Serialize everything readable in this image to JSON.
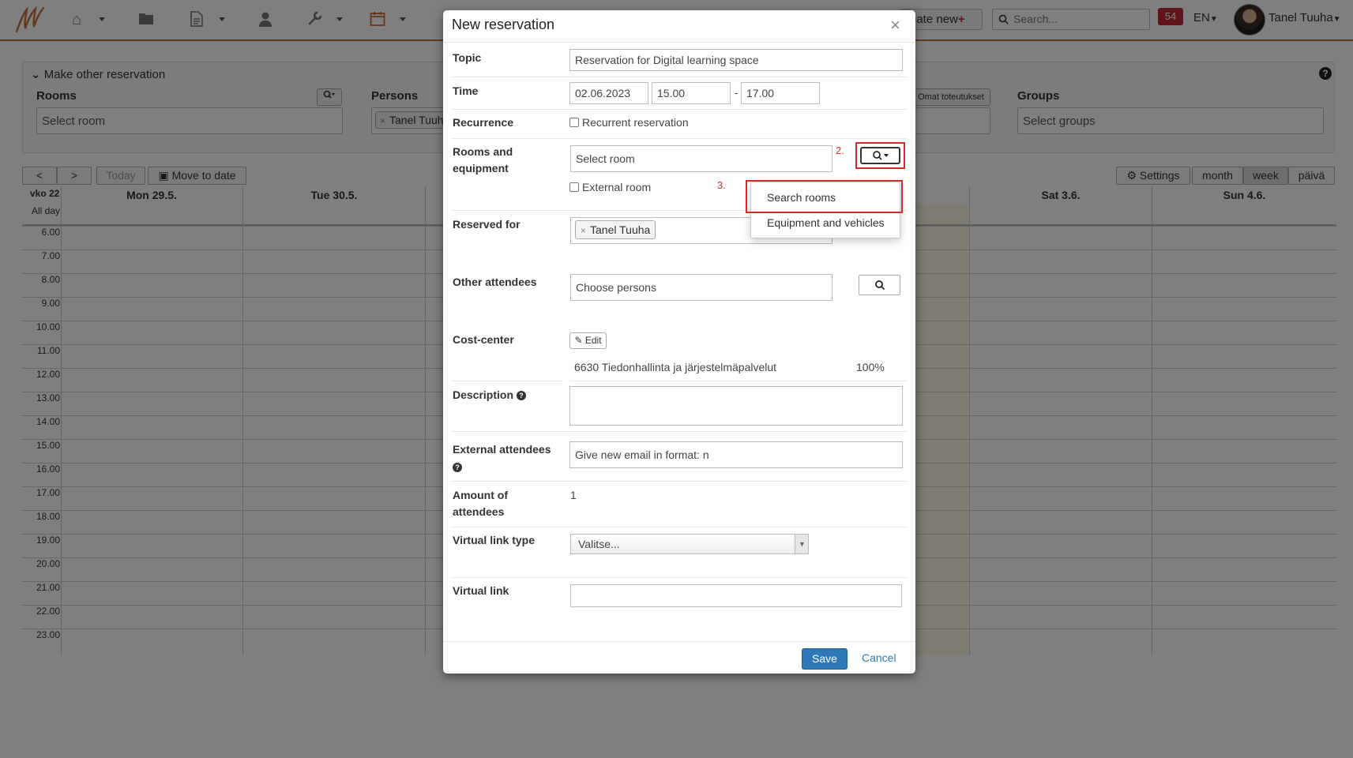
{
  "nav": {
    "create_new_label": "reate new",
    "search_placeholder": "Search...",
    "notifications_count": "54",
    "language": "EN",
    "user_name": "Tanel Tuuha"
  },
  "panel": {
    "header": "Make other reservation",
    "rooms_label": "Rooms",
    "rooms_placeholder": "Select room",
    "persons_label": "Persons",
    "persons_tag": "Tanel Tuuh",
    "own_impl_button": "Omat toteutukset",
    "groups_label": "Groups",
    "groups_placeholder": "Select groups"
  },
  "calendar": {
    "prev": "<",
    "next": ">",
    "today": "Today",
    "move_to_date": "Move to date",
    "settings": "Settings",
    "views": [
      "month",
      "week",
      "päivä"
    ],
    "active_view": "week",
    "week_label": "vko 22",
    "all_day": "All day",
    "days": [
      "Mon 29.5.",
      "Tue 30.5.",
      "Sat 3.6.",
      "Sun 4.6."
    ],
    "hours": [
      "6.00",
      "7.00",
      "8.00",
      "9.00",
      "10.00",
      "11.00",
      "12.00",
      "13.00",
      "14.00",
      "15.00",
      "16.00",
      "17.00",
      "18.00",
      "19.00",
      "20.00",
      "21.00",
      "22.00",
      "23.00"
    ]
  },
  "modal": {
    "title": "New reservation",
    "topic_label": "Topic",
    "topic_value": "Reservation for Digital learning space",
    "time_label": "Time",
    "date_value": "02.06.2023",
    "start_time": "15.00",
    "time_separator": "-",
    "end_time": "17.00",
    "recurrence_label": "Recurrence",
    "recurrent_checkbox": "Recurrent reservation",
    "rooms_label": "Rooms and equipment",
    "rooms_placeholder": "Select room",
    "external_room_checkbox": "External room",
    "annotation_2": "2.",
    "annotation_3": "3.",
    "dropdown": {
      "search_rooms": "Search rooms",
      "equipment": "Equipment and vehicles"
    },
    "reserved_for_label": "Reserved for",
    "reserved_for_tag": "Tanel Tuuha",
    "other_attendees_label": "Other attendees",
    "other_attendees_placeholder": "Choose persons",
    "cost_center_label": "Cost-center",
    "edit_button": "Edit",
    "cost_center_name": "6630 Tiedonhallinta ja järjestelmäpalvelut",
    "cost_center_share": "100%",
    "description_label": "Description",
    "external_attendees_label": "External attendees",
    "external_attendees_placeholder": "Give new email in format: n",
    "amount_label": "Amount of attendees",
    "amount_value": "1",
    "virtual_link_type_label": "Virtual link type",
    "virtual_link_type_value": "Valitse...",
    "virtual_link_label": "Virtual link",
    "save": "Save",
    "cancel": "Cancel"
  }
}
